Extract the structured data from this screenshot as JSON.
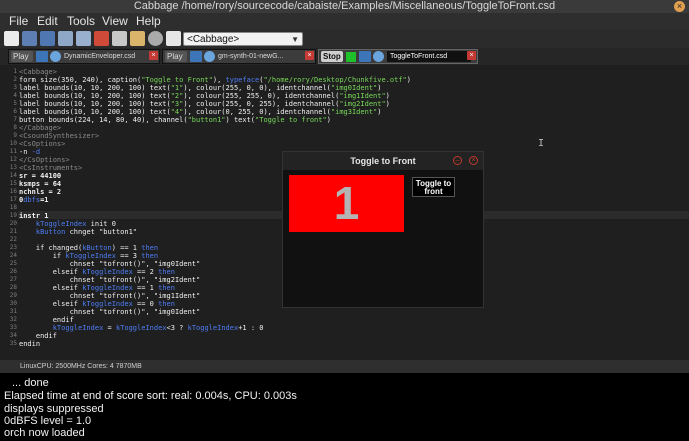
{
  "window": {
    "title": "Cabbage /home/rory/sourcecode/cabaiste/Examples/Miscellaneous/ToggleToFront.csd"
  },
  "menu": [
    "File",
    "Edit",
    "Tools",
    "View",
    "Help"
  ],
  "toolbar": {
    "icons": [
      "new-file-icon",
      "open-folder-icon",
      "save-icon",
      "save-as-icon",
      "save-all-icon",
      "cut-icon",
      "copy-icon",
      "paste-icon",
      "settings-icon",
      "export-icon"
    ],
    "combo": "<Cabbage>"
  },
  "tabs": [
    {
      "play": "Play",
      "name": "DynamicEnveloper.csd",
      "active": false
    },
    {
      "play": "Play",
      "name": "gm-synth-01-newG...",
      "active": false
    },
    {
      "play": "Stop",
      "name": "ToggleToFront.csd",
      "active": true
    }
  ],
  "code": [
    [
      {
        "t": "<Cabbage>",
        "c": "gray"
      }
    ],
    [
      {
        "t": "form size(350, 240), caption(",
        "c": "white"
      },
      {
        "t": "\"Toggle to Front\"",
        "c": "green"
      },
      {
        "t": "), ",
        "c": "white"
      },
      {
        "t": "typeface",
        "c": "blue"
      },
      {
        "t": "(",
        "c": "white"
      },
      {
        "t": "\"/home/rory/Desktop/Chunkfive.otf\"",
        "c": "green"
      },
      {
        "t": ")",
        "c": "white"
      }
    ],
    [
      {
        "t": "label bounds(10, 10, 200, 100) text(",
        "c": "white"
      },
      {
        "t": "\"1\"",
        "c": "green"
      },
      {
        "t": "), colour(255, 0, 0), identchannel(",
        "c": "white"
      },
      {
        "t": "\"img0Ident\"",
        "c": "green"
      },
      {
        "t": ")",
        "c": "white"
      }
    ],
    [
      {
        "t": "label bounds(10, 10, 200, 100) text(",
        "c": "white"
      },
      {
        "t": "\"2\"",
        "c": "green"
      },
      {
        "t": "), colour(255, 255, 0), identchannel(",
        "c": "white"
      },
      {
        "t": "\"img1Ident\"",
        "c": "green"
      },
      {
        "t": ")",
        "c": "white"
      }
    ],
    [
      {
        "t": "label bounds(10, 10, 200, 100) text(",
        "c": "white"
      },
      {
        "t": "\"3\"",
        "c": "green"
      },
      {
        "t": "), colour(255, 0, 255), identchannel(",
        "c": "white"
      },
      {
        "t": "\"img2Ident\"",
        "c": "green"
      },
      {
        "t": ")",
        "c": "white"
      }
    ],
    [
      {
        "t": "label bounds(10, 10, 200, 100) text(",
        "c": "white"
      },
      {
        "t": "\"4\"",
        "c": "green"
      },
      {
        "t": "), colour(0, 255, 0), identchannel(",
        "c": "white"
      },
      {
        "t": "\"img3Ident\"",
        "c": "green"
      },
      {
        "t": ")",
        "c": "white"
      }
    ],
    [
      {
        "t": "button bounds(224, 14, 80, 40), channel(",
        "c": "white"
      },
      {
        "t": "\"button1\"",
        "c": "green"
      },
      {
        "t": ") text(",
        "c": "white"
      },
      {
        "t": "\"Toggle to front\"",
        "c": "green"
      },
      {
        "t": ")",
        "c": "white"
      }
    ],
    [
      {
        "t": "</Cabbage>",
        "c": "gray"
      }
    ],
    [
      {
        "t": "<CsoundSynthesizer>",
        "c": "gray"
      }
    ],
    [
      {
        "t": "<CsOptions>",
        "c": "gray"
      }
    ],
    [
      {
        "t": "-n ",
        "c": "white"
      },
      {
        "t": "-d",
        "c": "blue"
      }
    ],
    [
      {
        "t": "</CsOptions>",
        "c": "gray"
      }
    ],
    [
      {
        "t": "<CsInstruments>",
        "c": "gray"
      }
    ],
    [
      {
        "t": "sr = 44100",
        "c": "white bold"
      }
    ],
    [
      {
        "t": "ksmps = 64",
        "c": "white bold"
      }
    ],
    [
      {
        "t": "nchnls = 2",
        "c": "white bold"
      }
    ],
    [
      {
        "t": "0",
        "c": "white bold"
      },
      {
        "t": "dbfs",
        "c": "blue"
      },
      {
        "t": "=1",
        "c": "white bold"
      }
    ],
    [
      {
        "t": "",
        "c": "white"
      }
    ],
    [
      {
        "t": "instr 1",
        "c": "white bold"
      }
    ],
    [
      {
        "t": "    ",
        "c": "white"
      },
      {
        "t": "kToggleIndex",
        "c": "blue"
      },
      {
        "t": " init 0",
        "c": "white"
      }
    ],
    [
      {
        "t": "    ",
        "c": "white"
      },
      {
        "t": "kButton",
        "c": "blue"
      },
      {
        "t": " chnget ",
        "c": "white"
      },
      {
        "t": "\"button1\"",
        "c": "white"
      }
    ],
    [
      {
        "t": "",
        "c": "white"
      }
    ],
    [
      {
        "t": "    if changed(",
        "c": "white"
      },
      {
        "t": "kButton",
        "c": "blue"
      },
      {
        "t": ") == 1 ",
        "c": "white"
      },
      {
        "t": "then",
        "c": "blue"
      }
    ],
    [
      {
        "t": "        if ",
        "c": "white"
      },
      {
        "t": "kToggleIndex",
        "c": "blue"
      },
      {
        "t": " == 3 ",
        "c": "white"
      },
      {
        "t": "then",
        "c": "blue"
      }
    ],
    [
      {
        "t": "            chnset ",
        "c": "white"
      },
      {
        "t": "\"tofront()\"",
        "c": "white"
      },
      {
        "t": ", ",
        "c": "white"
      },
      {
        "t": "\"img0Ident\"",
        "c": "white"
      }
    ],
    [
      {
        "t": "        elseif ",
        "c": "white"
      },
      {
        "t": "kToggleIndex",
        "c": "blue"
      },
      {
        "t": " == 2 ",
        "c": "white"
      },
      {
        "t": "then",
        "c": "blue"
      }
    ],
    [
      {
        "t": "            chnset ",
        "c": "white"
      },
      {
        "t": "\"tofront()\"",
        "c": "white"
      },
      {
        "t": ", ",
        "c": "white"
      },
      {
        "t": "\"img2Ident\"",
        "c": "white"
      }
    ],
    [
      {
        "t": "        elseif ",
        "c": "white"
      },
      {
        "t": "kToggleIndex",
        "c": "blue"
      },
      {
        "t": " == 1 ",
        "c": "white"
      },
      {
        "t": "then",
        "c": "blue"
      }
    ],
    [
      {
        "t": "            chnset ",
        "c": "white"
      },
      {
        "t": "\"tofront()\"",
        "c": "white"
      },
      {
        "t": ", ",
        "c": "white"
      },
      {
        "t": "\"img1Ident\"",
        "c": "white"
      }
    ],
    [
      {
        "t": "        elseif ",
        "c": "white"
      },
      {
        "t": "kToggleIndex",
        "c": "blue"
      },
      {
        "t": " == 0 ",
        "c": "white"
      },
      {
        "t": "then",
        "c": "blue"
      }
    ],
    [
      {
        "t": "            chnset ",
        "c": "white"
      },
      {
        "t": "\"tofront()\"",
        "c": "white"
      },
      {
        "t": ", ",
        "c": "white"
      },
      {
        "t": "\"img0Ident\"",
        "c": "white"
      }
    ],
    [
      {
        "t": "        endif",
        "c": "white"
      }
    ],
    [
      {
        "t": "        ",
        "c": "white"
      },
      {
        "t": "kToggleIndex",
        "c": "blue"
      },
      {
        "t": " = ",
        "c": "white"
      },
      {
        "t": "kToggleIndex",
        "c": "blue"
      },
      {
        "t": "<3 ? ",
        "c": "white"
      },
      {
        "t": "kToggleIndex",
        "c": "blue"
      },
      {
        "t": "+1 : 0",
        "c": "white"
      }
    ],
    [
      {
        "t": "    endif",
        "c": "white"
      }
    ],
    [
      {
        "t": "endin",
        "c": "white"
      }
    ]
  ],
  "plugin": {
    "title": "Toggle to Front",
    "label": "1",
    "label_colour": "#ff0000",
    "button": "Toggle to front"
  },
  "status": {
    "cpu": "LinuxCPU: 2500MHz  Cores: 4  7870MB"
  },
  "console": [
    "... done",
    "Elapsed time at end of score sort: real: 0.004s, CPU: 0.003s",
    "displays suppressed",
    "0dBFS level = 1.0",
    "orch now loaded"
  ]
}
